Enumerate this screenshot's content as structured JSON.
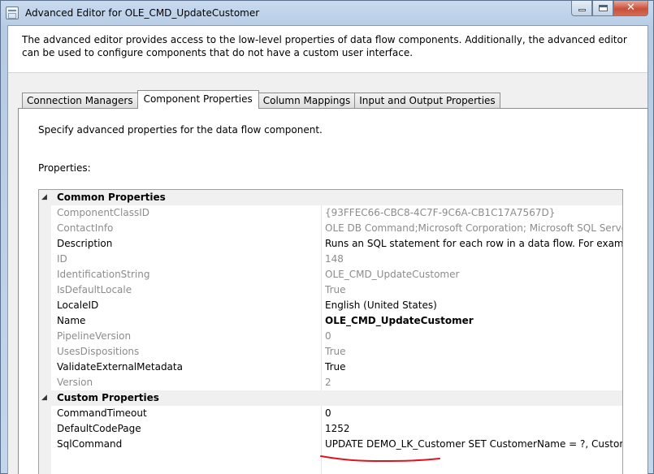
{
  "window": {
    "title": "Advanced Editor for OLE_CMD_UpdateCustomer",
    "app_icon": "dialog-icon",
    "buttons": {
      "minimize": "minimize-icon",
      "maximize": "maximize-icon",
      "close": "close-icon"
    }
  },
  "intro": {
    "text": "The advanced editor provides access to the low-level properties of data flow components. Additionally, the advanced editor can be used to configure components that do not have a custom user interface."
  },
  "tabs": [
    {
      "label": "Connection Managers",
      "active": false
    },
    {
      "label": "Component Properties",
      "active": true
    },
    {
      "label": "Column Mappings",
      "active": false
    },
    {
      "label": "Input and Output Properties",
      "active": false
    }
  ],
  "panel": {
    "description": "Specify advanced properties for the data flow component.",
    "properties_label": "Properties:"
  },
  "grid": {
    "categories": [
      {
        "name": "Common Properties",
        "rows": [
          {
            "name": "ComponentClassID",
            "value": "{93FFEC66-CBC8-4C7F-9C6A-CB1C17A7567D}",
            "readonly": true
          },
          {
            "name": "ContactInfo",
            "value": "OLE DB Command;Microsoft Corporation; Microsoft SQL Server; (C) M",
            "readonly": true
          },
          {
            "name": "Description",
            "value": "Runs an SQL statement for each row in a data flow. For example, call a",
            "readonly": false
          },
          {
            "name": "ID",
            "value": "148",
            "readonly": true
          },
          {
            "name": "IdentificationString",
            "value": "OLE_CMD_UpdateCustomer",
            "readonly": true
          },
          {
            "name": "IsDefaultLocale",
            "value": "True",
            "readonly": true
          },
          {
            "name": "LocaleID",
            "value": "English (United States)",
            "readonly": false
          },
          {
            "name": "Name",
            "value": "OLE_CMD_UpdateCustomer",
            "readonly": false,
            "bold": true
          },
          {
            "name": "PipelineVersion",
            "value": "0",
            "readonly": true
          },
          {
            "name": "UsesDispositions",
            "value": "True",
            "readonly": true
          },
          {
            "name": "ValidateExternalMetadata",
            "value": "True",
            "readonly": false
          },
          {
            "name": "Version",
            "value": "2",
            "readonly": true
          }
        ]
      },
      {
        "name": "Custom Properties",
        "rows": [
          {
            "name": "CommandTimeout",
            "value": "0",
            "readonly": false
          },
          {
            "name": "DefaultCodePage",
            "value": "1252",
            "readonly": false
          },
          {
            "name": "SqlCommand",
            "value": "UPDATE DEMO_LK_Customer SET CustomerName = ?, CustomerCom",
            "readonly": false
          }
        ]
      }
    ]
  },
  "colors": {
    "annotation_red": "#e0141e",
    "disabled_text": "#8c8c8c"
  }
}
